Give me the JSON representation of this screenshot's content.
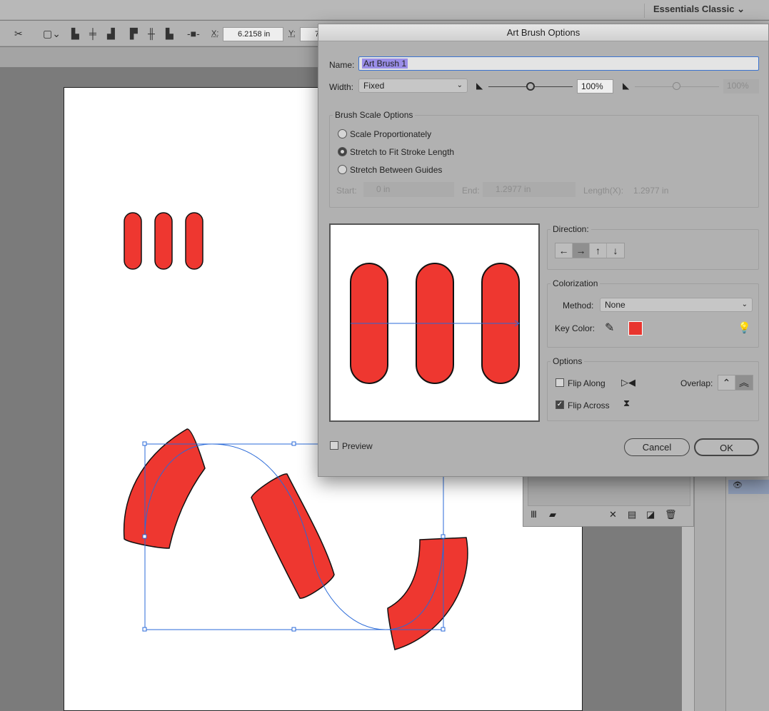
{
  "topbar": {
    "workspace": "Essentials Classic",
    "workspace_icon": "chevron-down-icon"
  },
  "toolbar": {
    "x_label": "X:",
    "x_value": "6.2158 in",
    "y_label": "Y:",
    "y_value": "7"
  },
  "dialog": {
    "title": "Art Brush Options",
    "name_label": "Name:",
    "name_value": "Art Brush 1",
    "width_label": "Width:",
    "width_value": "Fixed",
    "width_percent": "100%",
    "width_percent2": "100%",
    "scale_group": "Brush Scale Options",
    "scale_options": [
      {
        "label": "Scale Proportionately",
        "selected": false
      },
      {
        "label": "Stretch to Fit Stroke Length",
        "selected": true
      },
      {
        "label": "Stretch Between Guides",
        "selected": false
      }
    ],
    "start_label": "Start:",
    "start_value": "0 in",
    "end_label": "End:",
    "end_value": "1.2977 in",
    "length_label": "Length(X):",
    "length_value": "1.2977 in",
    "direction_label": "Direction:",
    "directions": [
      "←",
      "→",
      "↑",
      "↓"
    ],
    "direction_selected": "→",
    "colorization_label": "Colorization",
    "method_label": "Method:",
    "method_value": "None",
    "key_color_label": "Key Color:",
    "key_color": "#e8352e",
    "options_label": "Options",
    "flip_along": "Flip Along",
    "flip_along_checked": false,
    "flip_across": "Flip Across",
    "flip_across_checked": true,
    "overlap_label": "Overlap:",
    "preview_label": "Preview",
    "preview_checked": false,
    "cancel": "Cancel",
    "ok": "OK"
  },
  "colors": {
    "brush_red": "#ee3730",
    "selection_blue": "#2a6ad8",
    "highlight": "#9a8ee8"
  }
}
